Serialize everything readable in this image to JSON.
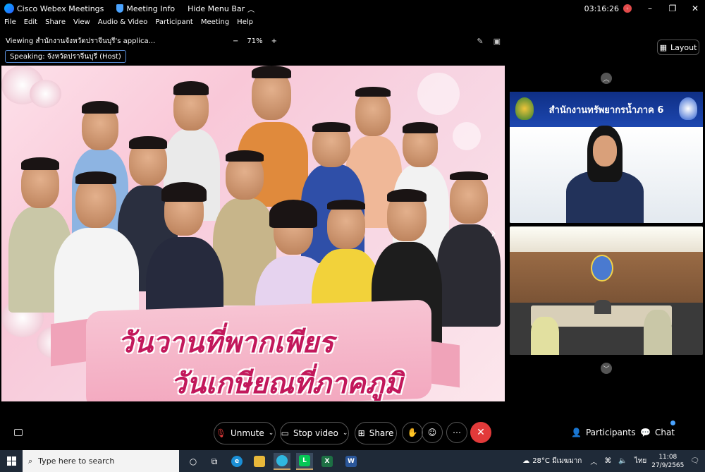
{
  "titlebar": {
    "app_name": "Cisco Webex Meetings",
    "meeting_info": "Meeting Info",
    "hide_menu": "Hide Menu Bar",
    "timer": "03:16:26"
  },
  "menu": [
    "File",
    "Edit",
    "Share",
    "View",
    "Audio & Video",
    "Participant",
    "Meeting",
    "Help"
  ],
  "viewing": {
    "label": "Viewing สำนักงานจังหวัดปราจีนบุรี's applica...",
    "zoom": "71%",
    "speaking": "Speaking: จังหวัดปราจีนบุรี (Host)"
  },
  "layout_label": "Layout",
  "shared": {
    "line1": "วันวานที่พากเพียร",
    "line2": "วันเกษียณที่ภาคภูมิ"
  },
  "video1": {
    "header": "สำนักงานทรัพยากรน้ำภาค 6"
  },
  "controls": {
    "unmute": "Unmute",
    "stop_video": "Stop video",
    "share": "Share",
    "participants": "Participants",
    "chat": "Chat"
  },
  "taskbar": {
    "search_placeholder": "Type here to search",
    "weather": "28°C มีเมฆมาก",
    "lang": "ไทย",
    "time": "11:08",
    "date": "27/9/2565"
  },
  "icons": {
    "accent": "#4aa3ff",
    "leave_color": "#e23a3a",
    "banner_text_color": "#c2185b"
  }
}
